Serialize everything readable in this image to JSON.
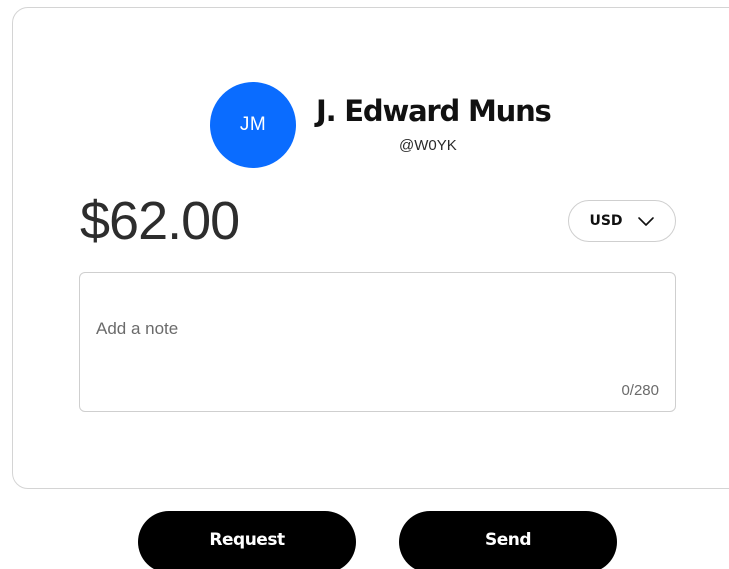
{
  "recipient": {
    "initials": "JM",
    "avatar_color": "#0a6cff",
    "name": "J. Edward Muns",
    "handle": "@W0YK"
  },
  "payment": {
    "amount": "$62.00",
    "currency": "USD",
    "currency_icon": "chevron-down-icon"
  },
  "note": {
    "placeholder": "Add a note",
    "value": "",
    "counter": "0/280"
  },
  "actions": {
    "request_label": "Request",
    "send_label": "Send",
    "button_color": "#000000"
  }
}
